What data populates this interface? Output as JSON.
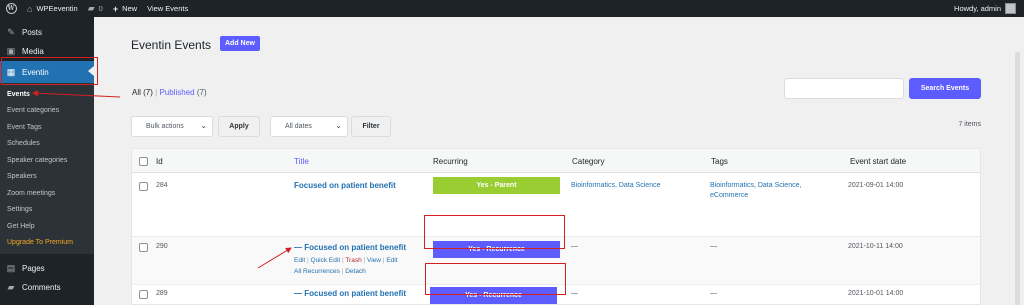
{
  "adminbar": {
    "site_name": "WPEeventin",
    "comments_count": "0",
    "new_label": "New",
    "view_events": "View Events",
    "howdy": "Howdy, admin"
  },
  "sidebar": {
    "top": [
      {
        "label": "Posts",
        "icon": "pushpin-icon"
      },
      {
        "label": "Media",
        "icon": "media-icon"
      },
      {
        "label": "Eventin",
        "icon": "calendar-icon"
      }
    ],
    "submenu": [
      "Events",
      "Event categories",
      "Event Tags",
      "Schedules",
      "Speaker categories",
      "Speakers",
      "Zoom meetings",
      "Settings",
      "Get Help",
      "Upgrade To Premium"
    ],
    "bottom": [
      {
        "label": "Pages",
        "icon": "page-icon"
      },
      {
        "label": "Comments",
        "icon": "comment-icon"
      }
    ]
  },
  "page": {
    "title": "Eventin Events",
    "add_new": "Add New",
    "view_all": "All",
    "view_all_count": "(7)",
    "view_published": "Published",
    "view_published_count": "(7)",
    "search_button": "Search Events",
    "bulk_actions": "Bulk actions",
    "apply": "Apply",
    "all_dates": "All dates",
    "filter": "Filter",
    "items_count": "7 items"
  },
  "table": {
    "headers": [
      "Id",
      "Title",
      "Recurring",
      "Category",
      "Tags",
      "Event start date"
    ],
    "rows": [
      {
        "id": "284",
        "title": "Focused on patient benefit",
        "recurring": "Yes - Parent",
        "category": "Bioinformatics, Data Science",
        "tags_line1": "Bioinformatics, Data Science,",
        "tags_line2": "eCommerce",
        "start": "2021-09-01 14:00"
      },
      {
        "id": "290",
        "title": "— Focused on patient benefit",
        "recurring": "Yes - Recurrence",
        "category": "—",
        "tags": "—",
        "start": "2021-10-11 14:00",
        "actions": {
          "edit": "Edit",
          "quick_edit": "Quick Edit",
          "trash": "Trash",
          "view": "View",
          "edit2": "Edit",
          "all_recurrences": "All Recurrences",
          "detach": "Detach"
        }
      },
      {
        "id": "289",
        "title": "— Focused on patient benefit",
        "recurring": "Yes - Recurrence",
        "category": "—",
        "tags": "—",
        "start": "2021-10-01 14:00"
      }
    ]
  },
  "colors": {
    "accent": "#5d5dff",
    "wp_blue": "#2271b1",
    "parent_badge": "#9acd32",
    "annotation_red": "#d42020"
  }
}
